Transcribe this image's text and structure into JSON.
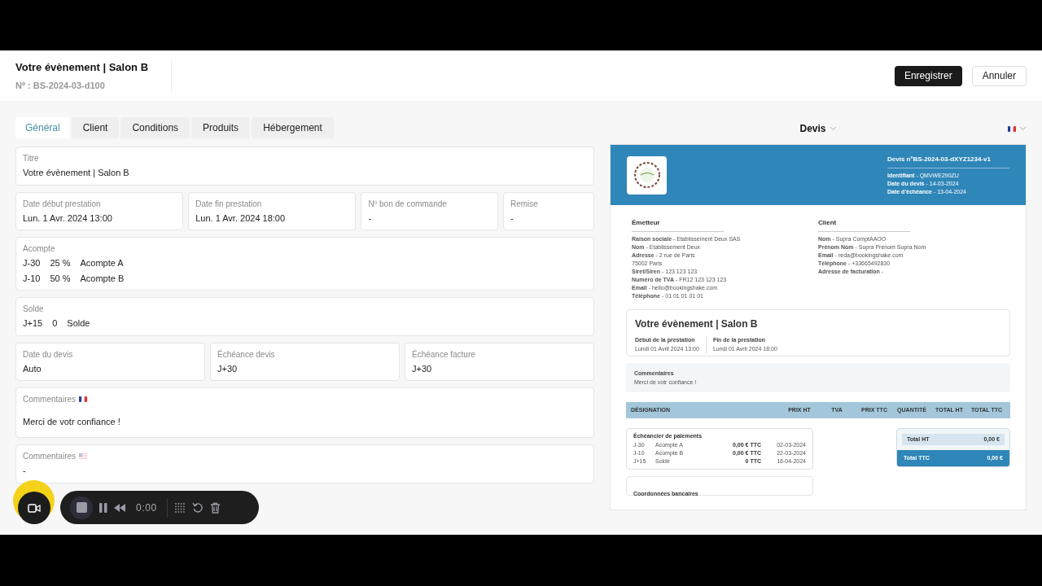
{
  "header": {
    "title": "Votre évènement | Salon B",
    "number": "Nº : BS-2024-03-d100",
    "buttons": [
      {
        "label": "Enregistrer",
        "kind": "primary"
      },
      {
        "label": "Annuler",
        "kind": "secondary"
      }
    ]
  },
  "tabs": [
    {
      "label": "Général",
      "selected": true
    },
    {
      "label": "Client",
      "selected": false
    },
    {
      "label": "Conditions",
      "selected": false
    },
    {
      "label": "Produits",
      "selected": false
    },
    {
      "label": "Hébergement",
      "selected": false
    }
  ],
  "form_rows": [
    [
      {
        "label": "Titre",
        "value": "Votre évènement | Salon B"
      }
    ],
    [
      {
        "label": "Date début prestation",
        "value": "Lun. 1 Avr. 2024 13:00"
      },
      {
        "label": "Date fin prestation",
        "value": "Lun. 1 Avr. 2024 18:00"
      },
      {
        "label": "Nº bon de commande",
        "value": "-"
      },
      {
        "label": "Remise",
        "value": "-"
      }
    ],
    [
      {
        "label": "Acompte",
        "lines": [
          [
            "J-30",
            "25 %",
            "Acompte A"
          ],
          [
            "J-10",
            "50 %",
            "Acompte B"
          ]
        ]
      }
    ],
    [
      {
        "label": "Solde",
        "lines": [
          [
            "J+15",
            "0",
            "Solde"
          ]
        ]
      }
    ],
    [
      {
        "label": "Date du devis",
        "value": "Auto"
      },
      {
        "label": "Échéance devis",
        "value": "J+30"
      },
      {
        "label": "Échéance facture",
        "value": "J+30"
      }
    ],
    [
      {
        "label": "Commentaires",
        "kind": "fr",
        "value": "Merci de votr confiance !"
      }
    ],
    [
      {
        "label": "Commentaires",
        "kind": "us",
        "value": "-"
      }
    ]
  ],
  "preview": {
    "doc_type": "Devis",
    "language": {
      "kind": "fr"
    },
    "doc_title": "Devis nºBS-2024-03-dXYZ1234-v1",
    "doc_info": [
      "**Identifiant** - QMVWE290ZU",
      "**Date du devis** - 14-03-2024",
      "**Date d'échéance** - 13-04-2024"
    ],
    "emitter": {
      "title": "Émetteur",
      "items": [
        "**Raison sociale** - Etablissement Deux SAS",
        "**Nom** - Etablissement Deux",
        "**Adresse** - 2 rue de Paris",
        "75002 Paris",
        "**Siret/Siren** - 123 123 123",
        "**Numéro de TVA** - FR12 123 123 123",
        "**Email** - hello@bookingshake.com",
        "**Téléphone** - 01 01 01 01 01"
      ]
    },
    "client": {
      "title": "Client",
      "items": [
        "**Nom** - Supra ComptAAOO",
        "**Prénom Nom** - Supra Prenom Supra Nom",
        "**Email** - reda@bookingshake.com",
        "**Téléphone** - +33665492830",
        "**Adresse de facturation** -"
      ]
    },
    "event": {
      "title": "Votre évènement | Salon B",
      "dates": [
        {
          "label": "Début de la prestation",
          "value": "Lundi 01 Avril 2024 13:00"
        },
        {
          "label": "Fin de la prestation",
          "value": "Lundi 01 Avril 2024 18:00"
        }
      ]
    },
    "comments": {
      "title": "Commentaires",
      "text": "Merci de votr confiance !"
    },
    "table_columns": [
      "DÉSIGNATION",
      "PRIX HT",
      "TVA",
      "PRIX TTC",
      "QUANTITÉ",
      "TOTAL HT",
      "TOTAL TTC"
    ],
    "schedule": {
      "title": "Échéancier de paiements",
      "rows": [
        [
          "J-30",
          "Acompte A",
          "0,00 € TTC",
          "02-03-2024"
        ],
        [
          "J-10",
          "Acompte B",
          "0,00 € TTC",
          "22-03-2024"
        ],
        [
          "J+15",
          "Solde",
          "0 TTC",
          "16-04-2024"
        ]
      ]
    },
    "totals": [
      {
        "label": "Total HT",
        "value": "0,00 €",
        "kind": "sub"
      },
      {
        "label": "Total TTC",
        "value": "0,00 €",
        "kind": "grand"
      }
    ],
    "bank_title": "Coordonnées bancaires"
  },
  "recorder": {
    "time": "0:00"
  }
}
